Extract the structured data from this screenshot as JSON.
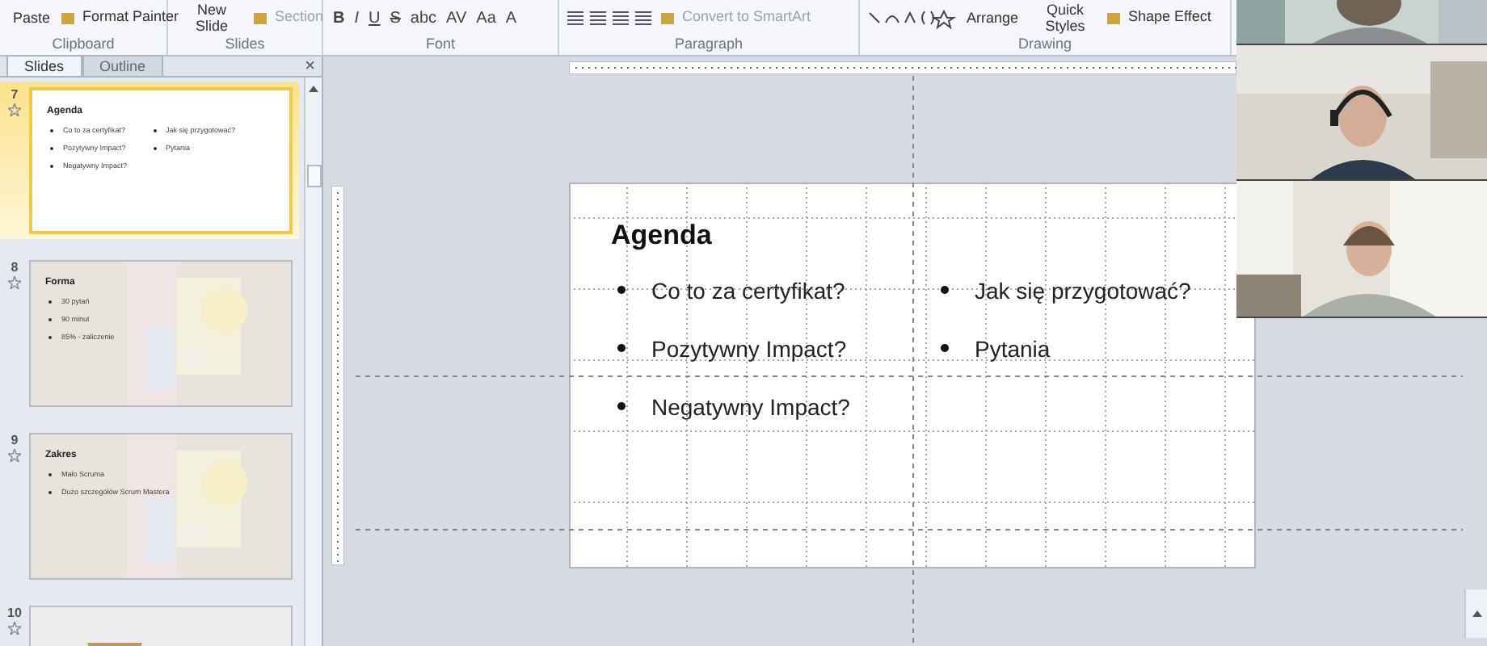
{
  "ribbon": {
    "groups": [
      {
        "label": "Clipboard",
        "items": [
          {
            "kind": "big",
            "label": "Paste"
          },
          {
            "kind": "small",
            "label": "Format Painter"
          }
        ]
      },
      {
        "label": "Slides",
        "items": [
          {
            "kind": "big",
            "label": "New Slide"
          },
          {
            "kind": "small",
            "label": "Section",
            "disabled": true
          }
        ]
      },
      {
        "label": "Font",
        "items": [
          {
            "kind": "glyph",
            "label": "B"
          },
          {
            "kind": "glyph",
            "label": "I"
          },
          {
            "kind": "glyph",
            "label": "U"
          },
          {
            "kind": "glyph",
            "label": "S"
          },
          {
            "kind": "glyph",
            "label": "abc"
          },
          {
            "kind": "glyph",
            "label": "AV"
          },
          {
            "kind": "glyph",
            "label": "Aa"
          },
          {
            "kind": "glyph",
            "label": "A"
          }
        ]
      },
      {
        "label": "Paragraph",
        "items": [
          {
            "kind": "align"
          },
          {
            "kind": "small",
            "label": "Convert to SmartArt",
            "disabled": true
          }
        ]
      },
      {
        "label": "Drawing",
        "items": [
          {
            "kind": "shapes"
          },
          {
            "kind": "big",
            "label": "Arrange"
          },
          {
            "kind": "big",
            "label": "Quick Styles"
          },
          {
            "kind": "small",
            "label": "Shape Effect"
          }
        ]
      }
    ]
  },
  "pane": {
    "tabs": [
      {
        "label": "Slides",
        "selected": true
      },
      {
        "label": "Outline",
        "selected": false
      }
    ],
    "close": "×",
    "slides": [
      {
        "number": "7",
        "selected": true,
        "kind": "plain",
        "title": "Agenda",
        "columns": [
          [
            "Co to za certyfikat?",
            "Pozytywny Impact?",
            "Negatywny Impact?"
          ],
          [
            "Jak się przygotować?",
            "Pytania"
          ]
        ]
      },
      {
        "number": "8",
        "selected": false,
        "title": "Forma",
        "columns": [
          [
            "30 pytań",
            "90 minut",
            "85% - zaliczenie"
          ]
        ]
      },
      {
        "number": "9",
        "selected": false,
        "title": "Zakres",
        "columns": [
          [
            "Mało Scruma",
            "Dużo szczegółów Scrum Mastera"
          ]
        ]
      },
      {
        "number": "10",
        "selected": false,
        "kind": "vase"
      }
    ]
  },
  "slide": {
    "title": "Agenda",
    "columns": [
      [
        "Co to za certyfikat?",
        "Pozytywny Impact?",
        "Negatywny Impact?"
      ],
      [
        "Jak się przygotować?",
        "Pytania"
      ]
    ]
  }
}
